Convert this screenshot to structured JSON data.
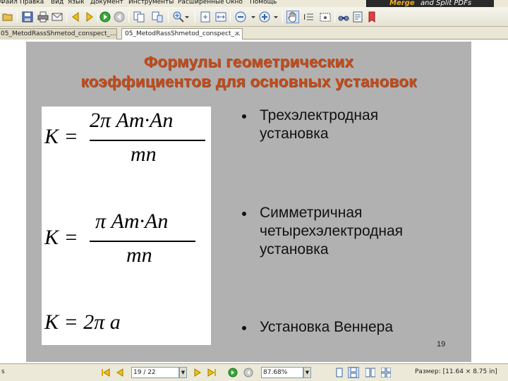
{
  "menu": {
    "items": [
      "Файл",
      "Правка",
      "Вид",
      "Язык",
      "Документ",
      "Инструменты",
      "Расширенные",
      "Окно",
      "Помощь"
    ]
  },
  "banner": {
    "part1": "Merge",
    "part2": "and Split PDFs"
  },
  "toolbar": {
    "icons": [
      "folder-icon",
      "save-icon",
      "print-icon",
      "email-icon",
      "prev-page-icon",
      "next-page-icon",
      "go-forward-icon",
      "go-back-icon",
      "copy-icon",
      "extract-icon",
      "zoom-in-icon",
      "zoom-dropdown-icon",
      "fit-page-icon",
      "fit-width-icon",
      "zoom-out-icon",
      "zoom-in-plus-icon",
      "hand-tool-icon",
      "select-text-icon",
      "snapshot-icon",
      "find-icon",
      "find-text-icon",
      "bookmark-icon"
    ]
  },
  "tabs": [
    {
      "label": "05_MetodRassShmetod_conspect_...",
      "active": false
    },
    {
      "label": "05_MetodRassShmetod_conspect_...",
      "active": true
    }
  ],
  "tab_close_symbol": "×",
  "slide": {
    "title_line1": "Формулы геометрических",
    "title_line2": "коэффициентов для основных установок",
    "formulas": {
      "f1_lhs": "K =",
      "f1_num": "2π  Am·An",
      "f1_den": "mn",
      "f2_lhs": "K =",
      "f2_num": "π  Am·An",
      "f2_den": "mn",
      "f3": "K = 2π  a"
    },
    "bullets": [
      {
        "line1": "Трехэлектродная",
        "line2": "установка"
      },
      {
        "line1": "Симметричная",
        "line2": "четырехэлектродная",
        "line3": "установка"
      },
      {
        "line1": "Установка  Веннера"
      }
    ],
    "page_number": "19"
  },
  "status": {
    "left_marker": "s",
    "page_field": "19 / 22",
    "zoom_field": "87.68%",
    "size_text": "Размер: [11.64 × 8.75 in]"
  },
  "colors": {
    "title": "#c74a17",
    "slide_bg": "#b1b1b1",
    "chrome": "#ece9d8"
  }
}
